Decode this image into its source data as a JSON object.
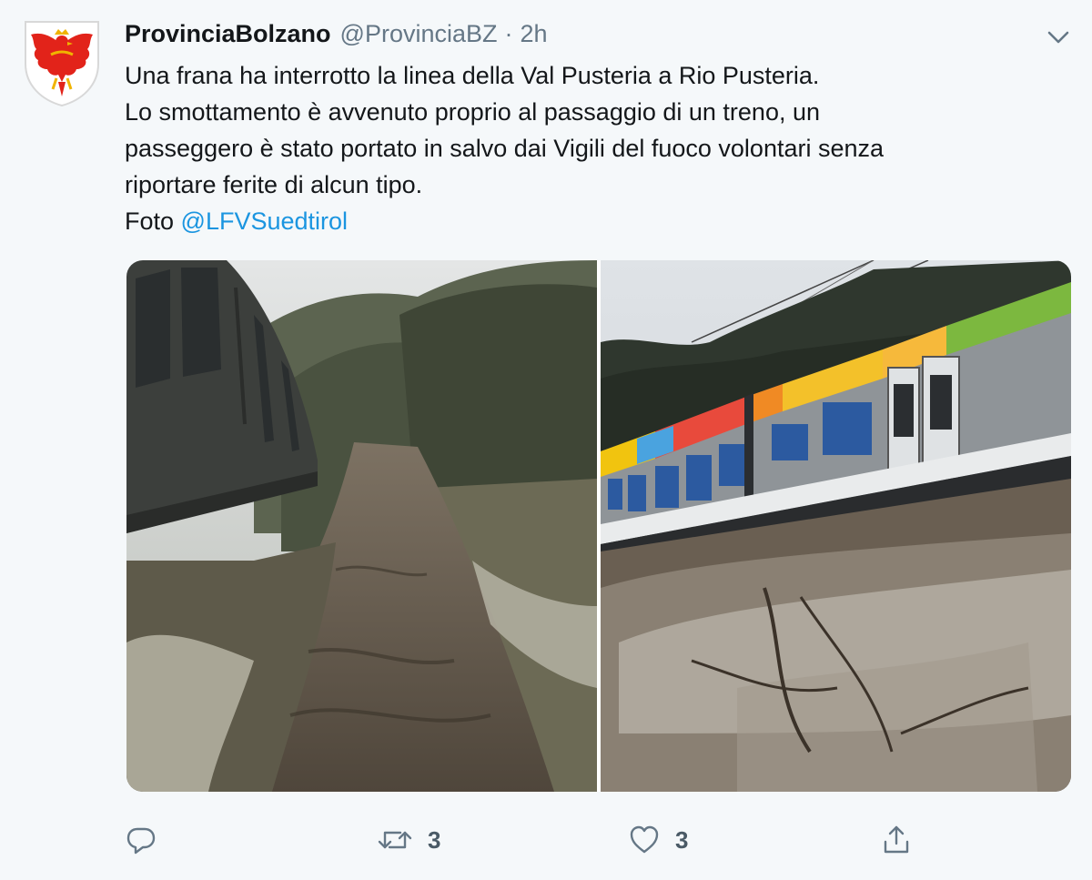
{
  "tweet": {
    "author_name": "ProvinciaBolzano",
    "author_handle": "@ProvinciaBZ",
    "separator": "·",
    "time": "2h",
    "text_lines": [
      "Una frana ha interrotto la linea della Val Pusteria a Rio Pusteria.",
      "Lo smottamento è avvenuto proprio al passaggio di un treno, un",
      "passeggero è stato portato in salvo dai Vigili del fuoco volontari senza",
      "riportare ferite di alcun tipo."
    ],
    "photo_credit_prefix": "Foto ",
    "photo_credit_mention": "@LFVSuedtirol"
  },
  "media": {
    "photos": [
      "landslide-mud-beside-train",
      "colorful-train-on-landslide-debris"
    ]
  },
  "actions": {
    "reply": {
      "icon": "reply-icon",
      "count": ""
    },
    "retweet": {
      "icon": "retweet-icon",
      "count": "3"
    },
    "like": {
      "icon": "heart-icon",
      "count": "3"
    },
    "share": {
      "icon": "share-icon",
      "count": ""
    }
  },
  "colors": {
    "background": "#f5f8fa",
    "link": "#1b95e0",
    "muted": "#657786",
    "crest_red": "#e2231a"
  }
}
